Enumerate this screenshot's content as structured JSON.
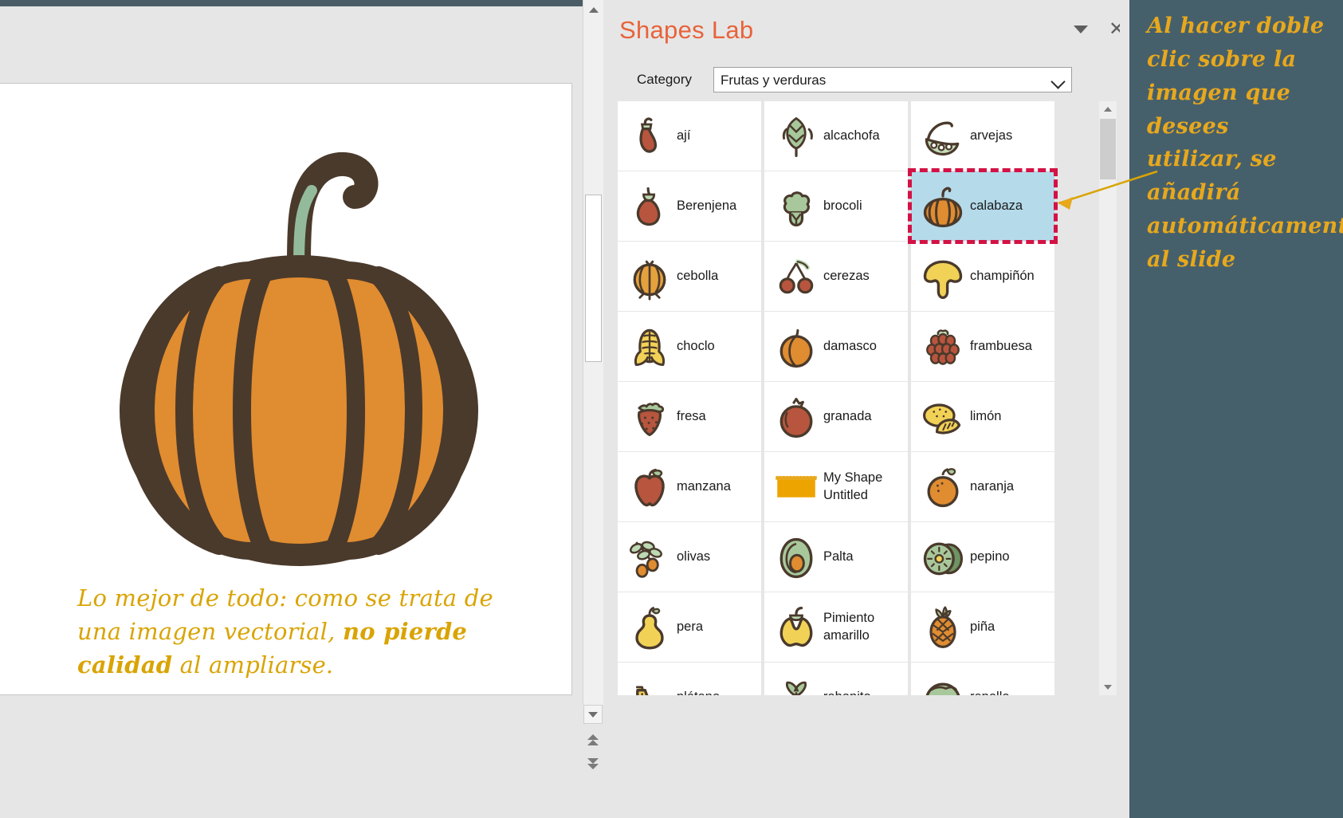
{
  "slide": {
    "caption_part1": "Lo mejor de todo: como se trata de una imagen vectorial, ",
    "caption_bold": "no pierde calidad",
    "caption_part2": " al ampliarse.",
    "shape_name": "pumpkin-illustration",
    "colors": {
      "pumpkin_body": "#e08c30",
      "pumpkin_outline": "#4a3a2c",
      "stem_green": "#93bb9b",
      "caption_gold": "#d9a404"
    }
  },
  "pane": {
    "title": "Shapes Lab",
    "collapse_icon": "chevron-down-icon",
    "close_label": "✕",
    "category": {
      "label": "Category",
      "value": "Frutas y verduras",
      "placeholder": "Frutas y verduras",
      "caret_icon": "chevron-down-icon"
    },
    "accent_color": "#e8633a",
    "selection_border_color": "#d31245",
    "selection_fill_color": "#b5dbea"
  },
  "shapes": [
    {
      "label": "ají",
      "icon": "chili-pepper-icon",
      "selected": false
    },
    {
      "label": "alcachofa",
      "icon": "artichoke-icon",
      "selected": false
    },
    {
      "label": "arvejas",
      "icon": "peas-pod-icon",
      "selected": false
    },
    {
      "label": "Berenjena",
      "icon": "eggplant-icon",
      "selected": false
    },
    {
      "label": "brocoli",
      "icon": "broccoli-icon",
      "selected": false
    },
    {
      "label": "calabaza",
      "icon": "pumpkin-icon",
      "selected": true
    },
    {
      "label": "cebolla",
      "icon": "onion-icon",
      "selected": false
    },
    {
      "label": "cerezas",
      "icon": "cherries-icon",
      "selected": false
    },
    {
      "label": "champiñón",
      "icon": "mushroom-icon",
      "selected": false
    },
    {
      "label": "choclo",
      "icon": "corn-icon",
      "selected": false
    },
    {
      "label": "damasco",
      "icon": "apricot-icon",
      "selected": false
    },
    {
      "label": "frambuesa",
      "icon": "raspberry-icon",
      "selected": false
    },
    {
      "label": "fresa",
      "icon": "strawberry-icon",
      "selected": false
    },
    {
      "label": "granada",
      "icon": "pomegranate-icon",
      "selected": false
    },
    {
      "label": "limón",
      "icon": "lemon-icon",
      "selected": false
    },
    {
      "label": "manzana",
      "icon": "apple-icon",
      "selected": false
    },
    {
      "label": "My Shape Untitled",
      "icon": "custom-shape-icon",
      "selected": false
    },
    {
      "label": "naranja",
      "icon": "orange-icon",
      "selected": false
    },
    {
      "label": "olivas",
      "icon": "olives-icon",
      "selected": false
    },
    {
      "label": "Palta",
      "icon": "avocado-icon",
      "selected": false
    },
    {
      "label": "pepino",
      "icon": "cucumber-icon",
      "selected": false
    },
    {
      "label": "pera",
      "icon": "pear-icon",
      "selected": false
    },
    {
      "label": "Pimiento amarillo",
      "icon": "bell-pepper-icon",
      "selected": false
    },
    {
      "label": "piña",
      "icon": "pineapple-icon",
      "selected": false
    },
    {
      "label": "plátano",
      "icon": "banana-icon",
      "selected": false
    },
    {
      "label": "rabanito",
      "icon": "radish-icon",
      "selected": false
    },
    {
      "label": "repollo",
      "icon": "cabbage-icon",
      "selected": false
    }
  ],
  "annotation": {
    "text": "Al hacer doble clic sobre la imagen que desees utilizar, se añadirá automáticamente al slide",
    "color": "#e8a81c",
    "background": "#46606b",
    "arrow": "callout-arrow"
  },
  "scrollbars": {
    "slide_up_icon": "triangle-up-icon",
    "slide_down_icon": "triangle-down-icon",
    "prev_slide_icon": "double-chevron-up-icon",
    "next_slide_icon": "double-chevron-down-icon",
    "grid_up_icon": "triangle-up-icon",
    "grid_down_icon": "triangle-down-icon"
  }
}
